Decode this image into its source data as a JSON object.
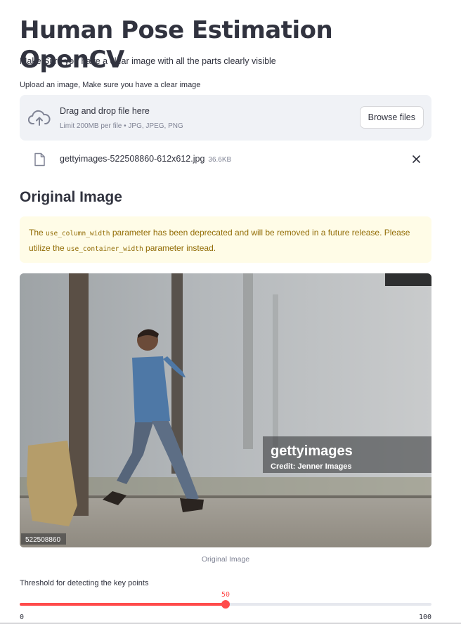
{
  "page": {
    "title": "Human Pose Estimation OpenCV",
    "subtitle": "Make Sure you have a clear image with all the parts clearly visible"
  },
  "uploader": {
    "label": "Upload an image, Make sure you have a clear image",
    "drop_text": "Drag and drop file here",
    "limit_text": "Limit 200MB per file • JPG, JPEG, PNG",
    "browse_label": "Browse files",
    "icon": "cloud-upload-icon",
    "file": {
      "name": "gettyimages-522508860-612x612.jpg",
      "size": "36.6KB",
      "icon": "file-icon"
    }
  },
  "section": {
    "heading": "Original Image"
  },
  "warning": {
    "part1": "The ",
    "code1": "use_column_width",
    "part2": " parameter has been deprecated and will be removed in a future release. Please utilize the ",
    "code2": "use_container_width",
    "part3": " parameter instead."
  },
  "image": {
    "watermark_brand": "gettyimages",
    "watermark_credit": "Credit: Jenner Images",
    "stock_id": "522508860",
    "caption": "Original Image"
  },
  "slider": {
    "label": "Threshold for detecting the key points",
    "value": 50,
    "min": 0,
    "max": 100,
    "value_text": "50",
    "min_text": "0",
    "max_text": "100",
    "color": "#ff4b4b"
  }
}
